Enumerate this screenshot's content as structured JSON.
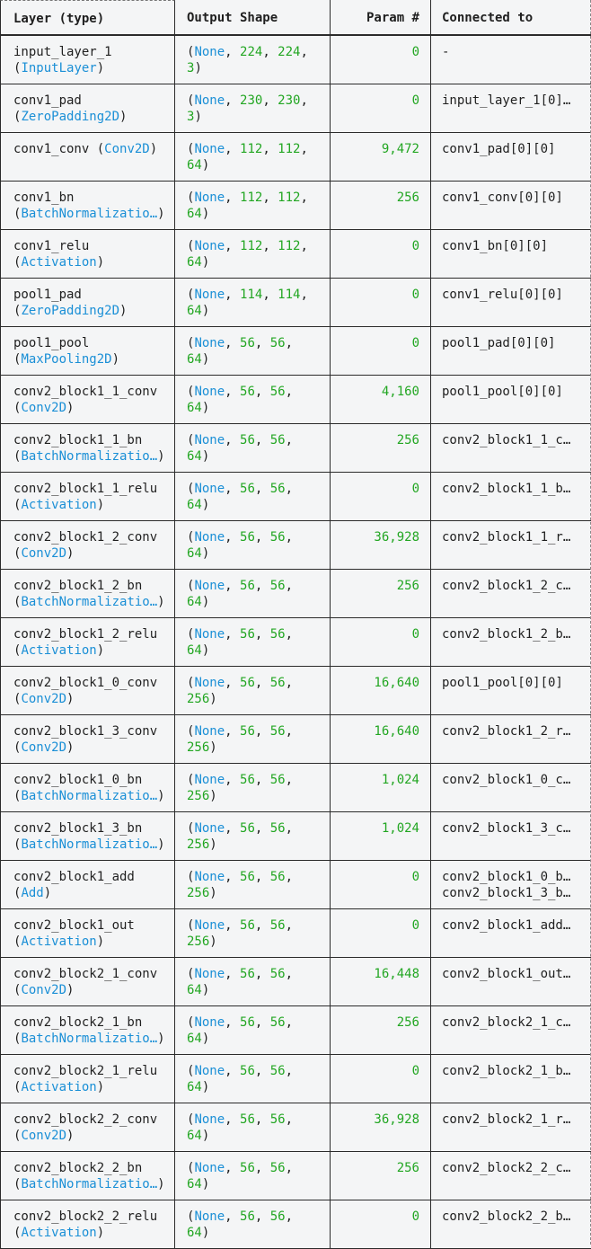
{
  "header": {
    "layer": "Layer (type)",
    "output": "Output Shape",
    "param": "Param #",
    "connected": "Connected to"
  },
  "rows": [
    {
      "name": "input_layer_1",
      "type": "InputLayer",
      "shape": [
        "224",
        "224",
        "3"
      ],
      "param": "0",
      "conn": [
        "-"
      ]
    },
    {
      "name": "conv1_pad",
      "type": "ZeroPadding2D",
      "shape": [
        "230",
        "230",
        "3"
      ],
      "param": "0",
      "conn": [
        "input_layer_1[0]…"
      ]
    },
    {
      "name": "conv1_conv",
      "type": "Conv2D",
      "shape": [
        "112",
        "112",
        "64"
      ],
      "param": "9,472",
      "conn": [
        "conv1_pad[0][0]"
      ],
      "inline": true
    },
    {
      "name": "conv1_bn",
      "type": "BatchNormalizatio…",
      "shape": [
        "112",
        "112",
        "64"
      ],
      "param": "256",
      "conn": [
        "conv1_conv[0][0]"
      ]
    },
    {
      "name": "conv1_relu",
      "type": "Activation",
      "shape": [
        "112",
        "112",
        "64"
      ],
      "param": "0",
      "conn": [
        "conv1_bn[0][0]"
      ]
    },
    {
      "name": "pool1_pad",
      "type": "ZeroPadding2D",
      "shape": [
        "114",
        "114",
        "64"
      ],
      "param": "0",
      "conn": [
        "conv1_relu[0][0]"
      ]
    },
    {
      "name": "pool1_pool",
      "type": "MaxPooling2D",
      "shape": [
        "56",
        "56",
        "64"
      ],
      "param": "0",
      "conn": [
        "pool1_pad[0][0]"
      ]
    },
    {
      "name": "conv2_block1_1_conv",
      "type": "Conv2D",
      "shape": [
        "56",
        "56",
        "64"
      ],
      "param": "4,160",
      "conn": [
        "pool1_pool[0][0]"
      ]
    },
    {
      "name": "conv2_block1_1_bn",
      "type": "BatchNormalizatio…",
      "shape": [
        "56",
        "56",
        "64"
      ],
      "param": "256",
      "conn": [
        "conv2_block1_1_c…"
      ]
    },
    {
      "name": "conv2_block1_1_relu",
      "type": "Activation",
      "shape": [
        "56",
        "56",
        "64"
      ],
      "param": "0",
      "conn": [
        "conv2_block1_1_b…"
      ]
    },
    {
      "name": "conv2_block1_2_conv",
      "type": "Conv2D",
      "shape": [
        "56",
        "56",
        "64"
      ],
      "param": "36,928",
      "conn": [
        "conv2_block1_1_r…"
      ]
    },
    {
      "name": "conv2_block1_2_bn",
      "type": "BatchNormalizatio…",
      "shape": [
        "56",
        "56",
        "64"
      ],
      "param": "256",
      "conn": [
        "conv2_block1_2_c…"
      ]
    },
    {
      "name": "conv2_block1_2_relu",
      "type": "Activation",
      "shape": [
        "56",
        "56",
        "64"
      ],
      "param": "0",
      "conn": [
        "conv2_block1_2_b…"
      ]
    },
    {
      "name": "conv2_block1_0_conv",
      "type": "Conv2D",
      "shape": [
        "56",
        "56",
        "256"
      ],
      "param": "16,640",
      "conn": [
        "pool1_pool[0][0]"
      ]
    },
    {
      "name": "conv2_block1_3_conv",
      "type": "Conv2D",
      "shape": [
        "56",
        "56",
        "256"
      ],
      "param": "16,640",
      "conn": [
        "conv2_block1_2_r…"
      ]
    },
    {
      "name": "conv2_block1_0_bn",
      "type": "BatchNormalizatio…",
      "shape": [
        "56",
        "56",
        "256"
      ],
      "param": "1,024",
      "conn": [
        "conv2_block1_0_c…"
      ]
    },
    {
      "name": "conv2_block1_3_bn",
      "type": "BatchNormalizatio…",
      "shape": [
        "56",
        "56",
        "256"
      ],
      "param": "1,024",
      "conn": [
        "conv2_block1_3_c…"
      ]
    },
    {
      "name": "conv2_block1_add",
      "type": "Add",
      "shape": [
        "56",
        "56",
        "256"
      ],
      "param": "0",
      "conn": [
        "conv2_block1_0_b…",
        "conv2_block1_3_b…"
      ]
    },
    {
      "name": "conv2_block1_out",
      "type": "Activation",
      "shape": [
        "56",
        "56",
        "256"
      ],
      "param": "0",
      "conn": [
        "conv2_block1_add…"
      ]
    },
    {
      "name": "conv2_block2_1_conv",
      "type": "Conv2D",
      "shape": [
        "56",
        "56",
        "64"
      ],
      "param": "16,448",
      "conn": [
        "conv2_block1_out…"
      ]
    },
    {
      "name": "conv2_block2_1_bn",
      "type": "BatchNormalizatio…",
      "shape": [
        "56",
        "56",
        "64"
      ],
      "param": "256",
      "conn": [
        "conv2_block2_1_c…"
      ]
    },
    {
      "name": "conv2_block2_1_relu",
      "type": "Activation",
      "shape": [
        "56",
        "56",
        "64"
      ],
      "param": "0",
      "conn": [
        "conv2_block2_1_b…"
      ]
    },
    {
      "name": "conv2_block2_2_conv",
      "type": "Conv2D",
      "shape": [
        "56",
        "56",
        "64"
      ],
      "param": "36,928",
      "conn": [
        "conv2_block2_1_r…"
      ]
    },
    {
      "name": "conv2_block2_2_bn",
      "type": "BatchNormalizatio…",
      "shape": [
        "56",
        "56",
        "64"
      ],
      "param": "256",
      "conn": [
        "conv2_block2_2_c…"
      ]
    },
    {
      "name": "conv2_block2_2_relu",
      "type": "Activation",
      "shape": [
        "56",
        "56",
        "64"
      ],
      "param": "0",
      "conn": [
        "conv2_block2_2_b…"
      ]
    }
  ],
  "colors": {
    "type": "#1a8fd6",
    "number": "#22a622",
    "text": "#1f1f1f",
    "border": "#2b2b2b",
    "background": "#f4f5f6"
  }
}
